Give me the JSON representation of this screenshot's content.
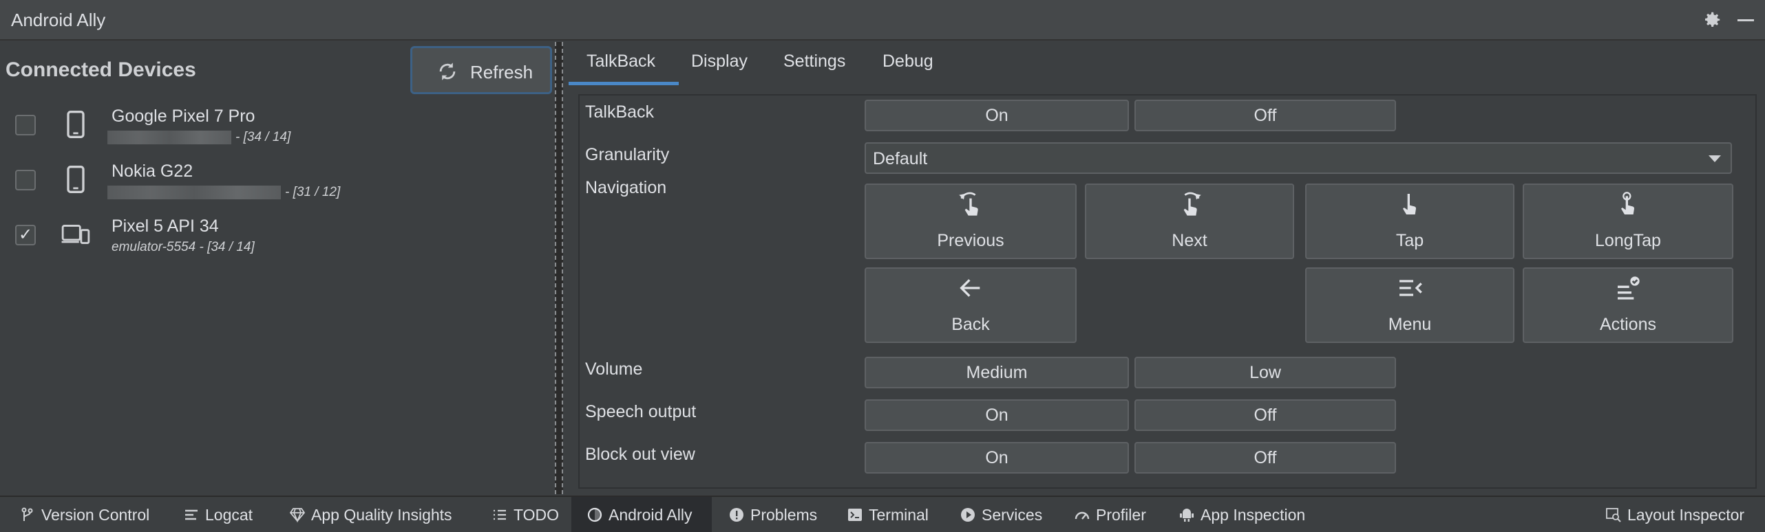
{
  "window": {
    "title": "Android Ally"
  },
  "devices_panel": {
    "heading": "Connected Devices",
    "refresh_label": "Refresh",
    "devices": [
      {
        "name": "Google Pixel 7 Pro",
        "serial": "",
        "api": "- [34 / 14]",
        "checked": false,
        "icon": "phone-icon"
      },
      {
        "name": "Nokia G22",
        "serial": "",
        "api": "- [31 / 12]",
        "checked": false,
        "icon": "phone-icon"
      },
      {
        "name": "Pixel 5 API 34",
        "serial": "emulator-5554",
        "api": "- [34 / 14]",
        "checked": true,
        "icon": "devices-icon"
      }
    ]
  },
  "tabs": [
    "TalkBack",
    "Display",
    "Settings",
    "Debug"
  ],
  "talkback": {
    "talkback_label": "TalkBack",
    "talkback_on": "On",
    "talkback_off": "Off",
    "granularity_label": "Granularity",
    "granularity_value": "Default",
    "navigation_label": "Navigation",
    "nav_previous": "Previous",
    "nav_next": "Next",
    "nav_tap": "Tap",
    "nav_longtap": "LongTap",
    "nav_back": "Back",
    "nav_menu": "Menu",
    "nav_actions": "Actions",
    "volume_label": "Volume",
    "volume_medium": "Medium",
    "volume_low": "Low",
    "speech_label": "Speech output",
    "speech_on": "On",
    "speech_off": "Off",
    "block_label": "Block out view",
    "block_on": "On",
    "block_off": "Off"
  },
  "toolwindows": [
    {
      "label": "Version Control",
      "icon": "branch-icon",
      "active": false
    },
    {
      "label": "Logcat",
      "icon": "logcat-icon",
      "active": false
    },
    {
      "label": "App Quality Insights",
      "icon": "diamond-icon",
      "active": false
    },
    {
      "label": "TODO",
      "icon": "list-icon",
      "active": false
    },
    {
      "label": "Android Ally",
      "icon": "ally-icon",
      "active": true
    },
    {
      "label": "Problems",
      "icon": "problems-icon",
      "active": false
    },
    {
      "label": "Terminal",
      "icon": "terminal-icon",
      "active": false
    },
    {
      "label": "Services",
      "icon": "play-icon",
      "active": false
    },
    {
      "label": "Profiler",
      "icon": "gauge-icon",
      "active": false
    },
    {
      "label": "App Inspection",
      "icon": "inspection-icon",
      "active": false
    },
    {
      "label": "Layout Inspector",
      "icon": "layout-inspector-icon",
      "active": false
    }
  ],
  "colors": {
    "accent": "#4a88c7",
    "panel": "#3c3f41",
    "button": "#4c5052"
  }
}
